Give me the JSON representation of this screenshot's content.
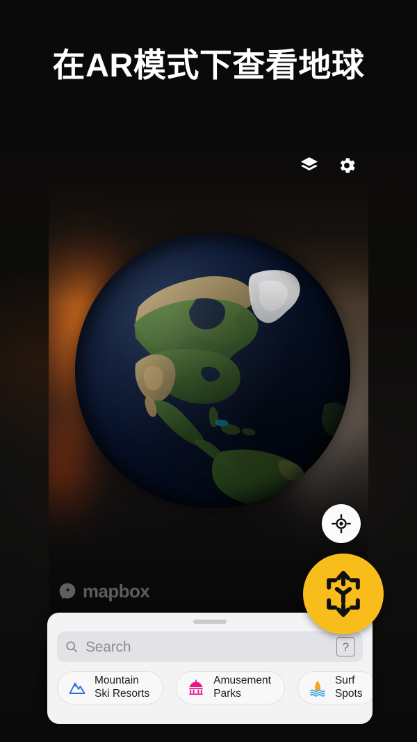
{
  "headline": "在AR模式下查看地球",
  "card": {
    "tools": [
      {
        "name": "layers-icon",
        "label": "Layers"
      },
      {
        "name": "settings-icon",
        "label": "Settings"
      }
    ],
    "attribution": "mapbox",
    "globe": {
      "alt": "3D Earth globe centred on North America",
      "ocean_color": "#0a1733",
      "land_green": "#3f6b2a",
      "land_tan": "#b59b63",
      "ice_color": "#f2f4f4"
    }
  },
  "controls": {
    "locate_label": "Locate me",
    "ar_label": "Enter AR mode",
    "ar_color": "#f9bd1b"
  },
  "sheet": {
    "search": {
      "placeholder": "Search",
      "help_label": "?"
    },
    "chips": [
      {
        "line1": "Mountain",
        "line2": "Ski Resorts",
        "icon": "mountain-icon",
        "color": "#2f6fe0"
      },
      {
        "line1": "Amusement",
        "line2": "Parks",
        "icon": "carousel-icon",
        "color": "#e8178f"
      },
      {
        "line1": "Surf",
        "line2": "Spots",
        "icon": "surf-icon",
        "color": "#f5a623"
      }
    ]
  }
}
